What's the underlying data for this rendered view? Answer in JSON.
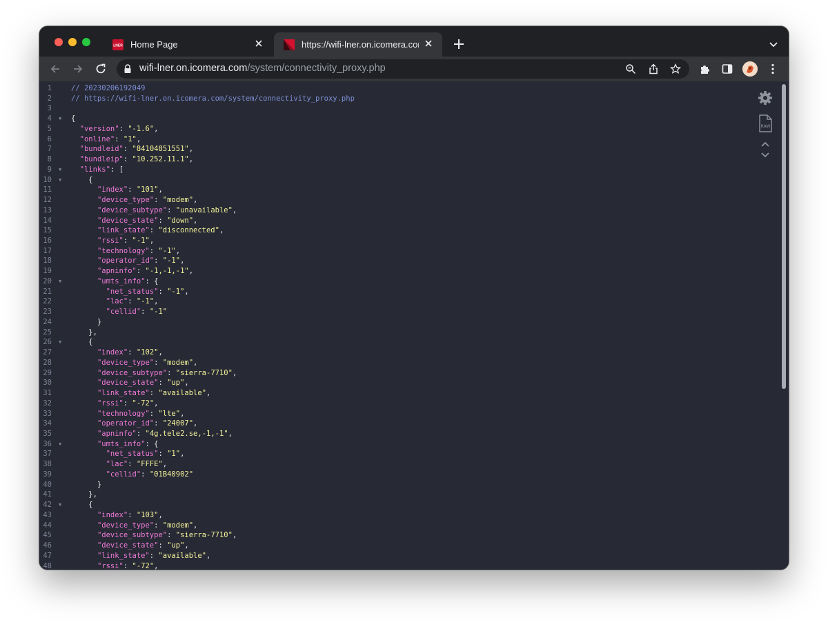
{
  "tabs": [
    {
      "title": "Home Page",
      "icon": "lner-favicon"
    },
    {
      "title": "https://wifi-lner.on.icomera.com/system/connectivity_proxy.php",
      "icon": "lner-favicon",
      "active": true
    }
  ],
  "address_bar": {
    "host": "wifi-lner.on.icomera.com",
    "path": "/system/connectivity_proxy.php"
  },
  "colors": {
    "key": "#f07ad8",
    "string": "#f5f29a",
    "comment": "#7d8fd4",
    "background": "#272a35"
  },
  "icons": [
    "back-icon",
    "forward-icon",
    "reload-icon",
    "lock-icon",
    "zoom-icon",
    "share-icon",
    "star-icon",
    "extensions-icon",
    "side-panel-icon",
    "menu-icon",
    "settings-gear-icon",
    "raw-icon",
    "collapse-expand-icon"
  ],
  "code_lines": [
    {
      "n": "1",
      "fold": "",
      "parts": [
        {
          "t": "c",
          "v": "// 20230206192049"
        }
      ]
    },
    {
      "n": "2",
      "fold": "",
      "parts": [
        {
          "t": "c",
          "v": "// https://wifi-lner.on.icomera.com/system/connectivity_proxy.php"
        }
      ]
    },
    {
      "n": "3",
      "fold": "",
      "parts": []
    },
    {
      "n": "4",
      "fold": "▼",
      "parts": [
        {
          "t": "p",
          "v": "{"
        }
      ]
    },
    {
      "n": "5",
      "fold": "",
      "parts": [
        {
          "t": "p",
          "v": "  "
        },
        {
          "t": "k",
          "v": "\"version\""
        },
        {
          "t": "p",
          "v": ": "
        },
        {
          "t": "s",
          "v": "\"-1.6\""
        },
        {
          "t": "p",
          "v": ","
        }
      ]
    },
    {
      "n": "6",
      "fold": "",
      "parts": [
        {
          "t": "p",
          "v": "  "
        },
        {
          "t": "k",
          "v": "\"online\""
        },
        {
          "t": "p",
          "v": ": "
        },
        {
          "t": "s",
          "v": "\"1\""
        },
        {
          "t": "p",
          "v": ","
        }
      ]
    },
    {
      "n": "7",
      "fold": "",
      "parts": [
        {
          "t": "p",
          "v": "  "
        },
        {
          "t": "k",
          "v": "\"bundleid\""
        },
        {
          "t": "p",
          "v": ": "
        },
        {
          "t": "s",
          "v": "\"84104851551\""
        },
        {
          "t": "p",
          "v": ","
        }
      ]
    },
    {
      "n": "8",
      "fold": "",
      "parts": [
        {
          "t": "p",
          "v": "  "
        },
        {
          "t": "k",
          "v": "\"bundleip\""
        },
        {
          "t": "p",
          "v": ": "
        },
        {
          "t": "s",
          "v": "\"10.252.11.1\""
        },
        {
          "t": "p",
          "v": ","
        }
      ]
    },
    {
      "n": "9",
      "fold": "▼",
      "parts": [
        {
          "t": "p",
          "v": "  "
        },
        {
          "t": "k",
          "v": "\"links\""
        },
        {
          "t": "p",
          "v": ": ["
        }
      ]
    },
    {
      "n": "10",
      "fold": "▼",
      "parts": [
        {
          "t": "p",
          "v": "    {"
        }
      ]
    },
    {
      "n": "11",
      "fold": "",
      "parts": [
        {
          "t": "p",
          "v": "      "
        },
        {
          "t": "k",
          "v": "\"index\""
        },
        {
          "t": "p",
          "v": ": "
        },
        {
          "t": "s",
          "v": "\"101\""
        },
        {
          "t": "p",
          "v": ","
        }
      ]
    },
    {
      "n": "12",
      "fold": "",
      "parts": [
        {
          "t": "p",
          "v": "      "
        },
        {
          "t": "k",
          "v": "\"device_type\""
        },
        {
          "t": "p",
          "v": ": "
        },
        {
          "t": "s",
          "v": "\"modem\""
        },
        {
          "t": "p",
          "v": ","
        }
      ]
    },
    {
      "n": "13",
      "fold": "",
      "parts": [
        {
          "t": "p",
          "v": "      "
        },
        {
          "t": "k",
          "v": "\"device_subtype\""
        },
        {
          "t": "p",
          "v": ": "
        },
        {
          "t": "s",
          "v": "\"unavailable\""
        },
        {
          "t": "p",
          "v": ","
        }
      ]
    },
    {
      "n": "14",
      "fold": "",
      "parts": [
        {
          "t": "p",
          "v": "      "
        },
        {
          "t": "k",
          "v": "\"device_state\""
        },
        {
          "t": "p",
          "v": ": "
        },
        {
          "t": "s",
          "v": "\"down\""
        },
        {
          "t": "p",
          "v": ","
        }
      ]
    },
    {
      "n": "15",
      "fold": "",
      "parts": [
        {
          "t": "p",
          "v": "      "
        },
        {
          "t": "k",
          "v": "\"link_state\""
        },
        {
          "t": "p",
          "v": ": "
        },
        {
          "t": "s",
          "v": "\"disconnected\""
        },
        {
          "t": "p",
          "v": ","
        }
      ]
    },
    {
      "n": "16",
      "fold": "",
      "parts": [
        {
          "t": "p",
          "v": "      "
        },
        {
          "t": "k",
          "v": "\"rssi\""
        },
        {
          "t": "p",
          "v": ": "
        },
        {
          "t": "s",
          "v": "\"-1\""
        },
        {
          "t": "p",
          "v": ","
        }
      ]
    },
    {
      "n": "17",
      "fold": "",
      "parts": [
        {
          "t": "p",
          "v": "      "
        },
        {
          "t": "k",
          "v": "\"technology\""
        },
        {
          "t": "p",
          "v": ": "
        },
        {
          "t": "s",
          "v": "\"-1\""
        },
        {
          "t": "p",
          "v": ","
        }
      ]
    },
    {
      "n": "18",
      "fold": "",
      "parts": [
        {
          "t": "p",
          "v": "      "
        },
        {
          "t": "k",
          "v": "\"operator_id\""
        },
        {
          "t": "p",
          "v": ": "
        },
        {
          "t": "s",
          "v": "\"-1\""
        },
        {
          "t": "p",
          "v": ","
        }
      ]
    },
    {
      "n": "19",
      "fold": "",
      "parts": [
        {
          "t": "p",
          "v": "      "
        },
        {
          "t": "k",
          "v": "\"apninfo\""
        },
        {
          "t": "p",
          "v": ": "
        },
        {
          "t": "s",
          "v": "\"-1,-1,-1\""
        },
        {
          "t": "p",
          "v": ","
        }
      ]
    },
    {
      "n": "20",
      "fold": "▼",
      "parts": [
        {
          "t": "p",
          "v": "      "
        },
        {
          "t": "k",
          "v": "\"umts_info\""
        },
        {
          "t": "p",
          "v": ": {"
        }
      ]
    },
    {
      "n": "21",
      "fold": "",
      "parts": [
        {
          "t": "p",
          "v": "        "
        },
        {
          "t": "k",
          "v": "\"net_status\""
        },
        {
          "t": "p",
          "v": ": "
        },
        {
          "t": "s",
          "v": "\"-1\""
        },
        {
          "t": "p",
          "v": ","
        }
      ]
    },
    {
      "n": "22",
      "fold": "",
      "parts": [
        {
          "t": "p",
          "v": "        "
        },
        {
          "t": "k",
          "v": "\"lac\""
        },
        {
          "t": "p",
          "v": ": "
        },
        {
          "t": "s",
          "v": "\"-1\""
        },
        {
          "t": "p",
          "v": ","
        }
      ]
    },
    {
      "n": "23",
      "fold": "",
      "parts": [
        {
          "t": "p",
          "v": "        "
        },
        {
          "t": "k",
          "v": "\"cellid\""
        },
        {
          "t": "p",
          "v": ": "
        },
        {
          "t": "s",
          "v": "\"-1\""
        }
      ]
    },
    {
      "n": "24",
      "fold": "",
      "parts": [
        {
          "t": "p",
          "v": "      }"
        }
      ]
    },
    {
      "n": "25",
      "fold": "",
      "parts": [
        {
          "t": "p",
          "v": "    },"
        }
      ]
    },
    {
      "n": "26",
      "fold": "▼",
      "parts": [
        {
          "t": "p",
          "v": "    {"
        }
      ]
    },
    {
      "n": "27",
      "fold": "",
      "parts": [
        {
          "t": "p",
          "v": "      "
        },
        {
          "t": "k",
          "v": "\"index\""
        },
        {
          "t": "p",
          "v": ": "
        },
        {
          "t": "s",
          "v": "\"102\""
        },
        {
          "t": "p",
          "v": ","
        }
      ]
    },
    {
      "n": "28",
      "fold": "",
      "parts": [
        {
          "t": "p",
          "v": "      "
        },
        {
          "t": "k",
          "v": "\"device_type\""
        },
        {
          "t": "p",
          "v": ": "
        },
        {
          "t": "s",
          "v": "\"modem\""
        },
        {
          "t": "p",
          "v": ","
        }
      ]
    },
    {
      "n": "29",
      "fold": "",
      "parts": [
        {
          "t": "p",
          "v": "      "
        },
        {
          "t": "k",
          "v": "\"device_subtype\""
        },
        {
          "t": "p",
          "v": ": "
        },
        {
          "t": "s",
          "v": "\"sierra-7710\""
        },
        {
          "t": "p",
          "v": ","
        }
      ]
    },
    {
      "n": "30",
      "fold": "",
      "parts": [
        {
          "t": "p",
          "v": "      "
        },
        {
          "t": "k",
          "v": "\"device_state\""
        },
        {
          "t": "p",
          "v": ": "
        },
        {
          "t": "s",
          "v": "\"up\""
        },
        {
          "t": "p",
          "v": ","
        }
      ]
    },
    {
      "n": "31",
      "fold": "",
      "parts": [
        {
          "t": "p",
          "v": "      "
        },
        {
          "t": "k",
          "v": "\"link_state\""
        },
        {
          "t": "p",
          "v": ": "
        },
        {
          "t": "s",
          "v": "\"available\""
        },
        {
          "t": "p",
          "v": ","
        }
      ]
    },
    {
      "n": "32",
      "fold": "",
      "parts": [
        {
          "t": "p",
          "v": "      "
        },
        {
          "t": "k",
          "v": "\"rssi\""
        },
        {
          "t": "p",
          "v": ": "
        },
        {
          "t": "s",
          "v": "\"-72\""
        },
        {
          "t": "p",
          "v": ","
        }
      ]
    },
    {
      "n": "33",
      "fold": "",
      "parts": [
        {
          "t": "p",
          "v": "      "
        },
        {
          "t": "k",
          "v": "\"technology\""
        },
        {
          "t": "p",
          "v": ": "
        },
        {
          "t": "s",
          "v": "\"lte\""
        },
        {
          "t": "p",
          "v": ","
        }
      ]
    },
    {
      "n": "34",
      "fold": "",
      "parts": [
        {
          "t": "p",
          "v": "      "
        },
        {
          "t": "k",
          "v": "\"operator_id\""
        },
        {
          "t": "p",
          "v": ": "
        },
        {
          "t": "s",
          "v": "\"24007\""
        },
        {
          "t": "p",
          "v": ","
        }
      ]
    },
    {
      "n": "35",
      "fold": "",
      "parts": [
        {
          "t": "p",
          "v": "      "
        },
        {
          "t": "k",
          "v": "\"apninfo\""
        },
        {
          "t": "p",
          "v": ": "
        },
        {
          "t": "s",
          "v": "\"4g.tele2.se,-1,-1\""
        },
        {
          "t": "p",
          "v": ","
        }
      ]
    },
    {
      "n": "36",
      "fold": "▼",
      "parts": [
        {
          "t": "p",
          "v": "      "
        },
        {
          "t": "k",
          "v": "\"umts_info\""
        },
        {
          "t": "p",
          "v": ": {"
        }
      ]
    },
    {
      "n": "37",
      "fold": "",
      "parts": [
        {
          "t": "p",
          "v": "        "
        },
        {
          "t": "k",
          "v": "\"net_status\""
        },
        {
          "t": "p",
          "v": ": "
        },
        {
          "t": "s",
          "v": "\"1\""
        },
        {
          "t": "p",
          "v": ","
        }
      ]
    },
    {
      "n": "38",
      "fold": "",
      "parts": [
        {
          "t": "p",
          "v": "        "
        },
        {
          "t": "k",
          "v": "\"lac\""
        },
        {
          "t": "p",
          "v": ": "
        },
        {
          "t": "s",
          "v": "\"FFFE\""
        },
        {
          "t": "p",
          "v": ","
        }
      ]
    },
    {
      "n": "39",
      "fold": "",
      "parts": [
        {
          "t": "p",
          "v": "        "
        },
        {
          "t": "k",
          "v": "\"cellid\""
        },
        {
          "t": "p",
          "v": ": "
        },
        {
          "t": "s",
          "v": "\"01B40902\""
        }
      ]
    },
    {
      "n": "40",
      "fold": "",
      "parts": [
        {
          "t": "p",
          "v": "      }"
        }
      ]
    },
    {
      "n": "41",
      "fold": "",
      "parts": [
        {
          "t": "p",
          "v": "    },"
        }
      ]
    },
    {
      "n": "42",
      "fold": "▼",
      "parts": [
        {
          "t": "p",
          "v": "    {"
        }
      ]
    },
    {
      "n": "43",
      "fold": "",
      "parts": [
        {
          "t": "p",
          "v": "      "
        },
        {
          "t": "k",
          "v": "\"index\""
        },
        {
          "t": "p",
          "v": ": "
        },
        {
          "t": "s",
          "v": "\"103\""
        },
        {
          "t": "p",
          "v": ","
        }
      ]
    },
    {
      "n": "44",
      "fold": "",
      "parts": [
        {
          "t": "p",
          "v": "      "
        },
        {
          "t": "k",
          "v": "\"device_type\""
        },
        {
          "t": "p",
          "v": ": "
        },
        {
          "t": "s",
          "v": "\"modem\""
        },
        {
          "t": "p",
          "v": ","
        }
      ]
    },
    {
      "n": "45",
      "fold": "",
      "parts": [
        {
          "t": "p",
          "v": "      "
        },
        {
          "t": "k",
          "v": "\"device_subtype\""
        },
        {
          "t": "p",
          "v": ": "
        },
        {
          "t": "s",
          "v": "\"sierra-7710\""
        },
        {
          "t": "p",
          "v": ","
        }
      ]
    },
    {
      "n": "46",
      "fold": "",
      "parts": [
        {
          "t": "p",
          "v": "      "
        },
        {
          "t": "k",
          "v": "\"device_state\""
        },
        {
          "t": "p",
          "v": ": "
        },
        {
          "t": "s",
          "v": "\"up\""
        },
        {
          "t": "p",
          "v": ","
        }
      ]
    },
    {
      "n": "47",
      "fold": "",
      "parts": [
        {
          "t": "p",
          "v": "      "
        },
        {
          "t": "k",
          "v": "\"link_state\""
        },
        {
          "t": "p",
          "v": ": "
        },
        {
          "t": "s",
          "v": "\"available\""
        },
        {
          "t": "p",
          "v": ","
        }
      ]
    },
    {
      "n": "48",
      "fold": "",
      "parts": [
        {
          "t": "p",
          "v": "      "
        },
        {
          "t": "k",
          "v": "\"rssi\""
        },
        {
          "t": "p",
          "v": ": "
        },
        {
          "t": "s",
          "v": "\"-72\""
        },
        {
          "t": "p",
          "v": ","
        }
      ]
    }
  ]
}
